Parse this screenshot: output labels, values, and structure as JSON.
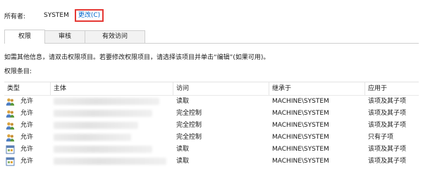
{
  "owner": {
    "label": "所有者:",
    "value": "SYSTEM",
    "change_link": "更改(C)"
  },
  "tabs": [
    {
      "label": "权限",
      "active": true
    },
    {
      "label": "审核",
      "active": false
    },
    {
      "label": "有效访问",
      "active": false
    }
  ],
  "hint": "如需其他信息，请双击权限项目。若要修改权限项目，请选择该项目并单击“编辑”(如果可用)。",
  "entries_label": "权限条目:",
  "table": {
    "columns": [
      "类型",
      "主体",
      "访问",
      "继承于",
      "应用于"
    ],
    "rows": [
      {
        "icon": "users-icon",
        "type": "允许",
        "principal": "",
        "access": "读取",
        "inherited_from": "MACHINE\\SYSTEM",
        "applies_to": "该项及其子项"
      },
      {
        "icon": "users-icon",
        "type": "允许",
        "principal": "",
        "access": "完全控制",
        "inherited_from": "MACHINE\\SYSTEM",
        "applies_to": "该项及其子项"
      },
      {
        "icon": "users-icon",
        "type": "允许",
        "principal": "",
        "access": "完全控制",
        "inherited_from": "MACHINE\\SYSTEM",
        "applies_to": "该项及其子项"
      },
      {
        "icon": "users-icon",
        "type": "允许",
        "principal": "",
        "access": "完全控制",
        "inherited_from": "MACHINE\\SYSTEM",
        "applies_to": "只有子项"
      },
      {
        "icon": "app-package-icon",
        "type": "允许",
        "principal": "",
        "access": "读取",
        "inherited_from": "MACHINE\\SYSTEM",
        "applies_to": "该项及其子项"
      },
      {
        "icon": "app-package-icon",
        "type": "允许",
        "principal": "",
        "access": "读取",
        "inherited_from": "MACHINE\\SYSTEM",
        "applies_to": "该项及其子项"
      }
    ]
  }
}
